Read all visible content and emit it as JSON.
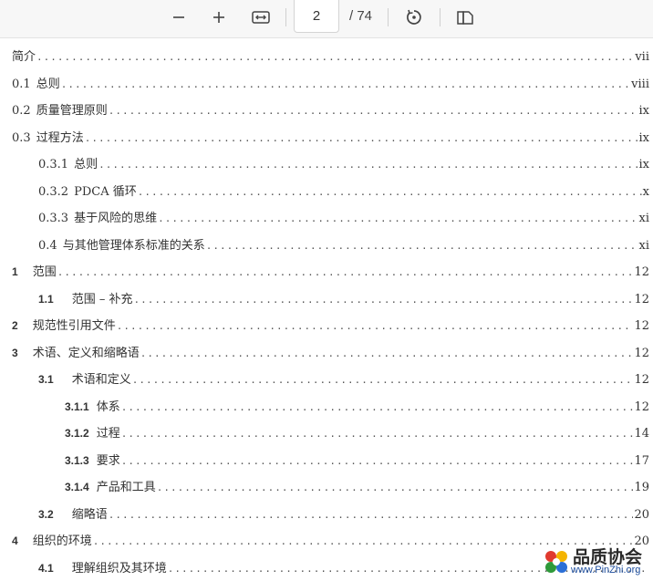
{
  "toolbar": {
    "zoom_out_icon": "minus-icon",
    "zoom_in_icon": "plus-icon",
    "fit_width_icon": "fit-width-icon",
    "current_page": "2",
    "total_pages": "/ 74",
    "rotate_icon": "rotate-icon",
    "two_page_icon": "page-view-icon"
  },
  "toc": [
    {
      "num": "",
      "title": "简介",
      "page": "vii"
    },
    {
      "num": "0.1",
      "title": "总则",
      "page": "viii"
    },
    {
      "num": "0.2",
      "title": "质量管理原则",
      "page": "ix"
    },
    {
      "num": "0.3",
      "title": "过程方法",
      "page": "ix"
    },
    {
      "num": "0.3.1",
      "title": "总则",
      "page": "ix"
    },
    {
      "num": "0.3.2",
      "title": "PDCA 循环",
      "page": "x"
    },
    {
      "num": "0.3.3",
      "title": "基于风险的思维",
      "page": "xi"
    },
    {
      "num": "0.4",
      "title": "与其他管理体系标准的关系",
      "page": "xi"
    },
    {
      "num": "1",
      "title": "范围",
      "page": "12"
    },
    {
      "num": "1.1",
      "title": "范围 – 补充",
      "page": "12"
    },
    {
      "num": "2",
      "title": "规范性引用文件",
      "page": "12"
    },
    {
      "num": "3",
      "title": "术语、定义和缩略语",
      "page": "12"
    },
    {
      "num": "3.1",
      "title": "术语和定义",
      "page": "12"
    },
    {
      "num": "3.1.1",
      "title": "体系",
      "page": "12"
    },
    {
      "num": "3.1.2",
      "title": "过程",
      "page": "14"
    },
    {
      "num": "3.1.3",
      "title": "要求",
      "page": "17"
    },
    {
      "num": "3.1.4",
      "title": "产品和工具",
      "page": "19"
    },
    {
      "num": "3.2",
      "title": "缩略语",
      "page": "20"
    },
    {
      "num": "4",
      "title": "组织的环境",
      "page": "20"
    },
    {
      "num": "4.1",
      "title": "理解组织及其环境",
      "page": ""
    }
  ],
  "watermark": {
    "name": "品质协会",
    "url": "www.PinZhi.org"
  }
}
